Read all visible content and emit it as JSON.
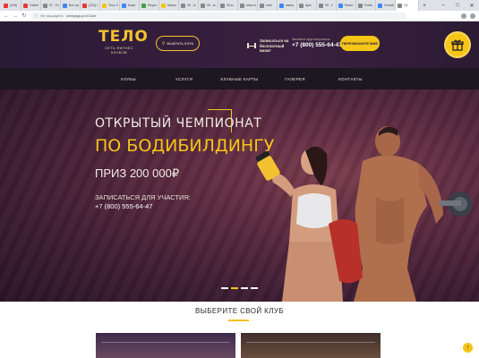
{
  "browser": {
    "tabs": [
      {
        "label": "(225)",
        "color": "#e53935"
      },
      {
        "label": "Online",
        "color": "#e53935"
      },
      {
        "label": "57 - Fo",
        "color": "#888888"
      },
      {
        "label": "Все пр",
        "color": "#4285f4"
      },
      {
        "label": "(224) I",
        "color": "#e53935"
      },
      {
        "label": "Тело Л",
        "color": "#f5c518"
      },
      {
        "label": "Комп",
        "color": "#4285f4"
      },
      {
        "label": "Рецеп",
        "color": "#43a047"
      },
      {
        "label": "Меню",
        "color": "#f5c518"
      },
      {
        "label": "99 - tc",
        "color": "#888888"
      },
      {
        "label": "99 - tc",
        "color": "#888888"
      },
      {
        "label": "99-tc",
        "color": "#888888"
      },
      {
        "label": "www-b",
        "color": "#888888"
      },
      {
        "label": "next",
        "color": "#888888"
      },
      {
        "label": "запис",
        "color": "#4285f4"
      },
      {
        "label": "Ajax",
        "color": "#888888"
      },
      {
        "label": "99 - 2",
        "color": "#888888"
      },
      {
        "label": "React",
        "color": "#4285f4"
      },
      {
        "label": "Portfo",
        "color": "#888888"
      },
      {
        "label": "Онлай",
        "color": "#4285f4"
      },
      {
        "label": "Се",
        "color": "#888888",
        "active": true
      }
    ],
    "url_secure": "Не защищено",
    "url": "centyaga.pro/Club/"
  },
  "header": {
    "logo": "ТЕЛО",
    "logo_sub": "СЕТЬ ФИТНЕС КЛУБОВ",
    "select_club": "ВЫБРАТЬ КЛУБ",
    "signup": "Записаться на бесплатный визит",
    "phone_label": "Звоните круглосуточно",
    "phone": "+7 (800) 555-64-47",
    "callback": "ПЕРЕЗВОНИТЕ МНЕ"
  },
  "menu": [
    "КЛУБЫ",
    "УСЛУГИ",
    "КЛУБНЫЕ КАРТЫ",
    "ГАЛЕРЕЯ",
    "КОНТАКТЫ"
  ],
  "hero": {
    "line1": "ОТКРЫТЫЙ ЧЕМПИОНАТ",
    "line2": "ПО БОДИБИЛДИНГУ",
    "prize": "ПРИЗ 200 000₽",
    "register": "ЗАПИСАТЬСЯ ДЛЯ УЧАСТИЯ:",
    "phone": "+7 (800) 555-64-47",
    "slides": 4,
    "active_slide": 2
  },
  "clubs": {
    "title": "ВЫБЕРИТЕ СВОЙ КЛУБ"
  },
  "colors": {
    "accent": "#f5c518",
    "header_bg": "#2a1a36",
    "menu_bg": "#1d1722"
  }
}
